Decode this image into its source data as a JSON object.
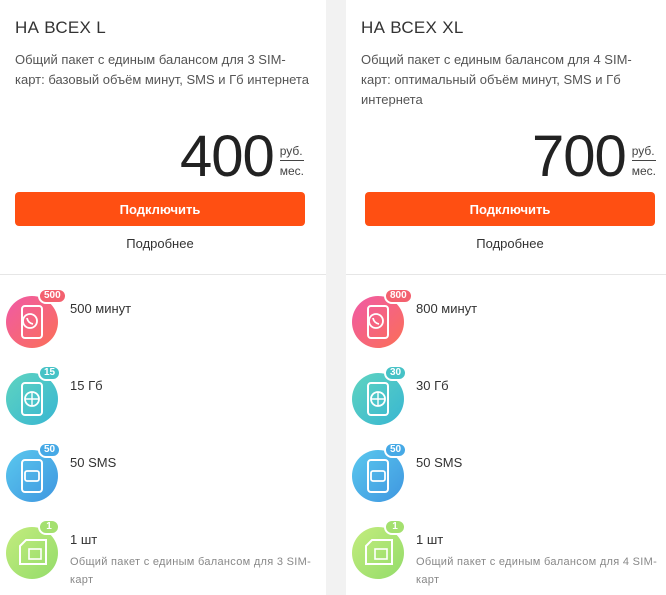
{
  "plans": [
    {
      "title": "НА ВСЕХ L",
      "description": "Общий пакет с единым балансом для 3 SIM-карт: базовый объём минут, SMS и Гб интернета",
      "price": "400",
      "price_unit_top": "руб.",
      "price_unit_bottom": "мес.",
      "connect_label": "Подключить",
      "details_label": "Подробнее",
      "features": {
        "minutes": {
          "badge": "500",
          "text": "500 минут",
          "icon": "phone-call-icon"
        },
        "internet": {
          "badge": "15",
          "text": "15 Гб",
          "icon": "globe-phone-icon"
        },
        "sms": {
          "badge": "50",
          "text": "50 SMS",
          "icon": "message-phone-icon"
        },
        "sim": {
          "badge": "1",
          "text": "1 шт",
          "sub": "Общий пакет с единым балансом для 3 SIM-карт",
          "icon": "sim-card-icon"
        }
      }
    },
    {
      "title": "НА ВСЕХ XL",
      "description": "Общий пакет с единым балансом для 4 SIM-карт: оптимальный объём минут, SMS и Гб интернета",
      "price": "700",
      "price_unit_top": "руб.",
      "price_unit_bottom": "мес.",
      "connect_label": "Подключить",
      "details_label": "Подробнее",
      "features": {
        "minutes": {
          "badge": "800",
          "text": "800 минут",
          "icon": "phone-call-icon"
        },
        "internet": {
          "badge": "30",
          "text": "30 Гб",
          "icon": "globe-phone-icon"
        },
        "sms": {
          "badge": "50",
          "text": "50 SMS",
          "icon": "message-phone-icon"
        },
        "sim": {
          "badge": "1",
          "text": "1 шт",
          "sub": "Общий пакет с единым балансом для 4 SIM-карт",
          "icon": "sim-card-icon"
        }
      }
    }
  ],
  "colors": {
    "accent": "#ff4f12",
    "minutes": "#f3616f",
    "internet": "#46c2c6",
    "sms": "#46a9e6",
    "sim": "#a4e06f"
  }
}
